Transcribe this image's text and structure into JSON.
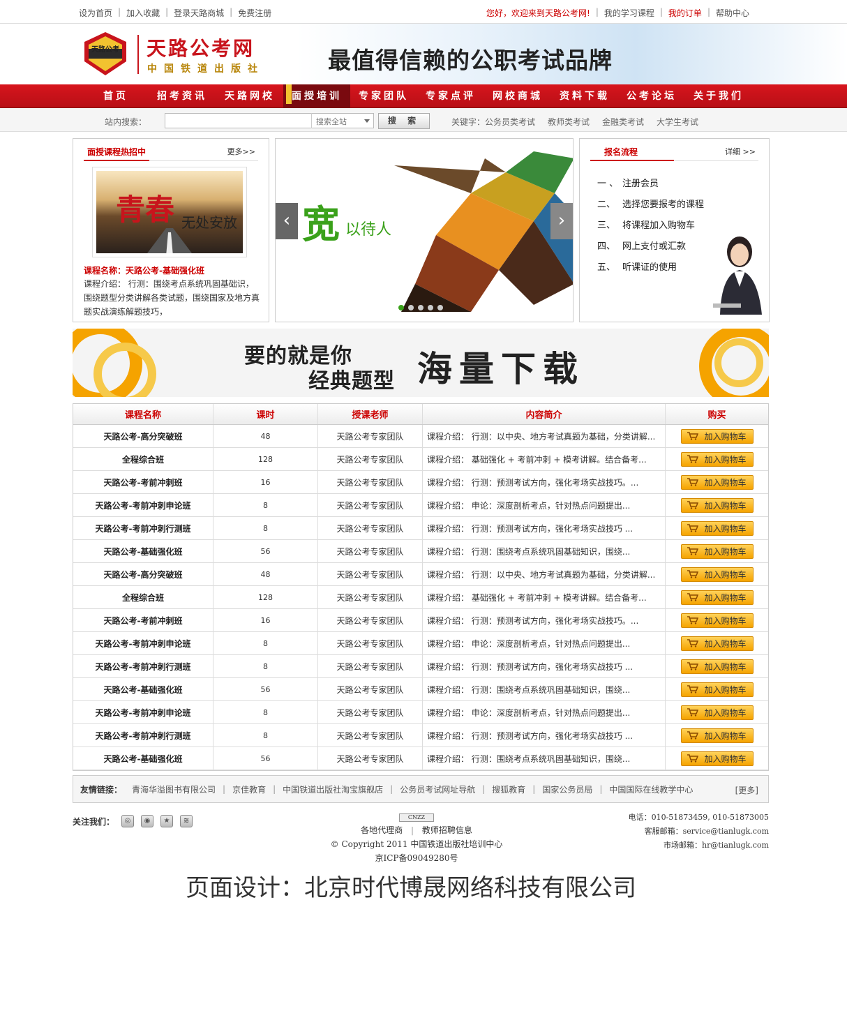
{
  "topbar": {
    "left": [
      "设为首页",
      "加入收藏",
      "登录天路商城",
      "免费注册"
    ],
    "welcome": "您好，欢迎来到天路公考网!",
    "right": [
      "我的学习课程",
      "我的订单",
      "帮助中心"
    ]
  },
  "header": {
    "logo_badge": "天路公考",
    "site_name": "天路公考网",
    "publisher": "中国铁道出版社",
    "slogan": "最值得信赖的公职考试品牌"
  },
  "nav": [
    "首页",
    "招考资讯",
    "天路网校",
    "面授培训",
    "专家团队",
    "专家点评",
    "网校商城",
    "资料下载",
    "公考论坛",
    "关于我们"
  ],
  "search": {
    "label": "站内搜索：",
    "input_value": "",
    "scope": "搜索全站",
    "button": "搜 索",
    "keywords_label": "关键字：公务员类考试",
    "keywords": [
      "教师类考试",
      "金融类考试",
      "大学生考试"
    ]
  },
  "hot_course": {
    "title": "面授课程热招中",
    "more": "更多>>",
    "img_big": "青春",
    "img_small": "无处安放",
    "name": "课程名称：天路公考-基础强化班",
    "desc": "课程介绍： 行测：围绕考点系统巩固基础识，围绕题型分类讲解各类试题，围绕国家及地方真题实战演练解题技巧，"
  },
  "slider": {
    "big_text": "宽",
    "small_text": "以待人",
    "prev": "‹",
    "next": "›",
    "slides": 5,
    "active": 0
  },
  "signup": {
    "title": "报名流程",
    "more": "详细 >>",
    "steps": [
      {
        "num": "一 、",
        "text": "注册会员"
      },
      {
        "num": "二、",
        "text": "选择您要报考的课程"
      },
      {
        "num": "三、",
        "text": "将课程加入购物车"
      },
      {
        "num": "四、",
        "text": "网上支付或汇款"
      },
      {
        "num": "五、",
        "text": "听课证的使用"
      }
    ]
  },
  "banner": {
    "line1": "要的就是你",
    "line2": "经典题型",
    "line3": "海量下载"
  },
  "table": {
    "headers": [
      "课程名称",
      "课时",
      "授课老师",
      "内容简介",
      "购买"
    ],
    "cart_label": "加入购物车",
    "rows": [
      [
        "天路公考-高分突破班",
        "48",
        "天路公考专家团队",
        "课程介绍： 行测：以中央、地方考试真题为基础，分类讲解..."
      ],
      [
        "全程综合班",
        "128",
        "天路公考专家团队",
        "课程介绍： 基础强化 + 考前冲刺 + 模考讲解。结合备考..."
      ],
      [
        "天路公考-考前冲刺班",
        "16",
        "天路公考专家团队",
        "课程介绍： 行测：预测考试方向，强化考场实战技巧。..."
      ],
      [
        "天路公考-考前冲刺申论班",
        "8",
        "天路公考专家团队",
        "课程介绍： 申论：深度剖析考点，针对热点问题提出..."
      ],
      [
        "天路公考-考前冲刺行测班",
        "8",
        "天路公考专家团队",
        "课程介绍： 行测：预测考试方向，强化考场实战技巧 ..."
      ],
      [
        "天路公考-基础强化班",
        "56",
        "天路公考专家团队",
        "课程介绍： 行测：围绕考点系统巩固基础知识，围绕..."
      ],
      [
        "天路公考-高分突破班",
        "48",
        "天路公考专家团队",
        "课程介绍： 行测：以中央、地方考试真题为基础，分类讲解..."
      ],
      [
        "全程综合班",
        "128",
        "天路公考专家团队",
        "课程介绍： 基础强化 + 考前冲刺 + 模考讲解。结合备考..."
      ],
      [
        "天路公考-考前冲刺班",
        "16",
        "天路公考专家团队",
        "课程介绍： 行测：预测考试方向，强化考场实战技巧。..."
      ],
      [
        "天路公考-考前冲刺申论班",
        "8",
        "天路公考专家团队",
        "课程介绍： 申论：深度剖析考点，针对热点问题提出..."
      ],
      [
        "天路公考-考前冲刺行测班",
        "8",
        "天路公考专家团队",
        "课程介绍： 行测：预测考试方向，强化考场实战技巧 ..."
      ],
      [
        "天路公考-基础强化班",
        "56",
        "天路公考专家团队",
        "课程介绍： 行测：围绕考点系统巩固基础知识，围绕..."
      ],
      [
        "天路公考-考前冲刺申论班",
        "8",
        "天路公考专家团队",
        "课程介绍： 申论：深度剖析考点，针对热点问题提出..."
      ],
      [
        "天路公考-考前冲刺行测班",
        "8",
        "天路公考专家团队",
        "课程介绍： 行测：预测考试方向，强化考场实战技巧 ..."
      ],
      [
        "天路公考-基础强化班",
        "56",
        "天路公考专家团队",
        "课程介绍： 行测：围绕考点系统巩固基础知识，围绕..."
      ]
    ]
  },
  "friend_links": {
    "label": "友情链接：",
    "items": [
      "青海华溢图书有限公司",
      "京佳教育",
      "中国铁道出版社淘宝旗舰店",
      "公务员考试网址导航",
      "搜狐教育",
      "国家公务员局",
      "中国国际在线教学中心"
    ],
    "more": "[更多]"
  },
  "footer": {
    "follow": "关注我们：",
    "cnzz": "CNZZ",
    "links": [
      "各地代理商",
      "教师招聘信息"
    ],
    "copyright": "© Copyright 2011 中国铁道出版社培训中心",
    "icp": "京ICP备09049280号",
    "phone": "电话：010-51873459, 010-51873005",
    "service_mail": "客服邮箱：service@tianlugk.com",
    "market_mail": "市场邮箱：hr@tianlugk.com"
  },
  "designer": "页面设计：北京时代博晟网络科技有限公司",
  "colors": {
    "brand_red": "#c8141c",
    "accent_orange": "#f5a300",
    "active_green": "#3aa11a"
  }
}
